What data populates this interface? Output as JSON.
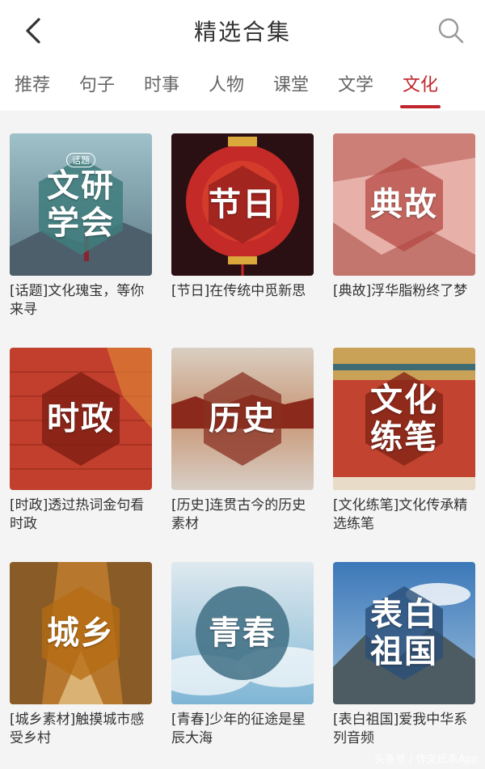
{
  "header": {
    "title": "精选合集",
    "back_icon": "chevron-left-icon",
    "search_icon": "search-icon"
  },
  "tabs": [
    {
      "label": "推荐"
    },
    {
      "label": "句子"
    },
    {
      "label": "时事"
    },
    {
      "label": "人物"
    },
    {
      "label": "课堂"
    },
    {
      "label": "文学"
    },
    {
      "label": "文化",
      "active": true
    }
  ],
  "colors": {
    "accent": "#c0262c",
    "background": "#f4f4f4"
  },
  "cards": [
    {
      "thumb_title": "文研",
      "thumb_title2": "学会",
      "badge": "话题",
      "caption": "[话题]文化瑰宝，等你来寻"
    },
    {
      "thumb_title": "节日",
      "thumb_title2": "",
      "caption": "[节日]在传统中觅新思"
    },
    {
      "thumb_title": "典故",
      "thumb_title2": "",
      "caption": "[典故]浮华脂粉终了梦"
    },
    {
      "thumb_title": "时政",
      "thumb_title2": "",
      "caption": "[时政]透过热词金句看时政"
    },
    {
      "thumb_title": "历史",
      "thumb_title2": "",
      "caption": "[历史]连贯古今的历史素材"
    },
    {
      "thumb_title": "文化",
      "thumb_title2": "练笔",
      "caption": "[文化练笔]文化传承精选练笔"
    },
    {
      "thumb_title": "城乡",
      "thumb_title2": "",
      "caption": "[城乡素材]触摸城市感受乡村"
    },
    {
      "thumb_title": "青春",
      "thumb_title2": "",
      "caption": "[青春]少年的征途是星辰大海"
    },
    {
      "thumb_title": "表白",
      "thumb_title2": "祖国",
      "caption": "[表白祖国]爱我中华系列音频"
    }
  ],
  "watermark": "头条号 / 作文纸条App"
}
